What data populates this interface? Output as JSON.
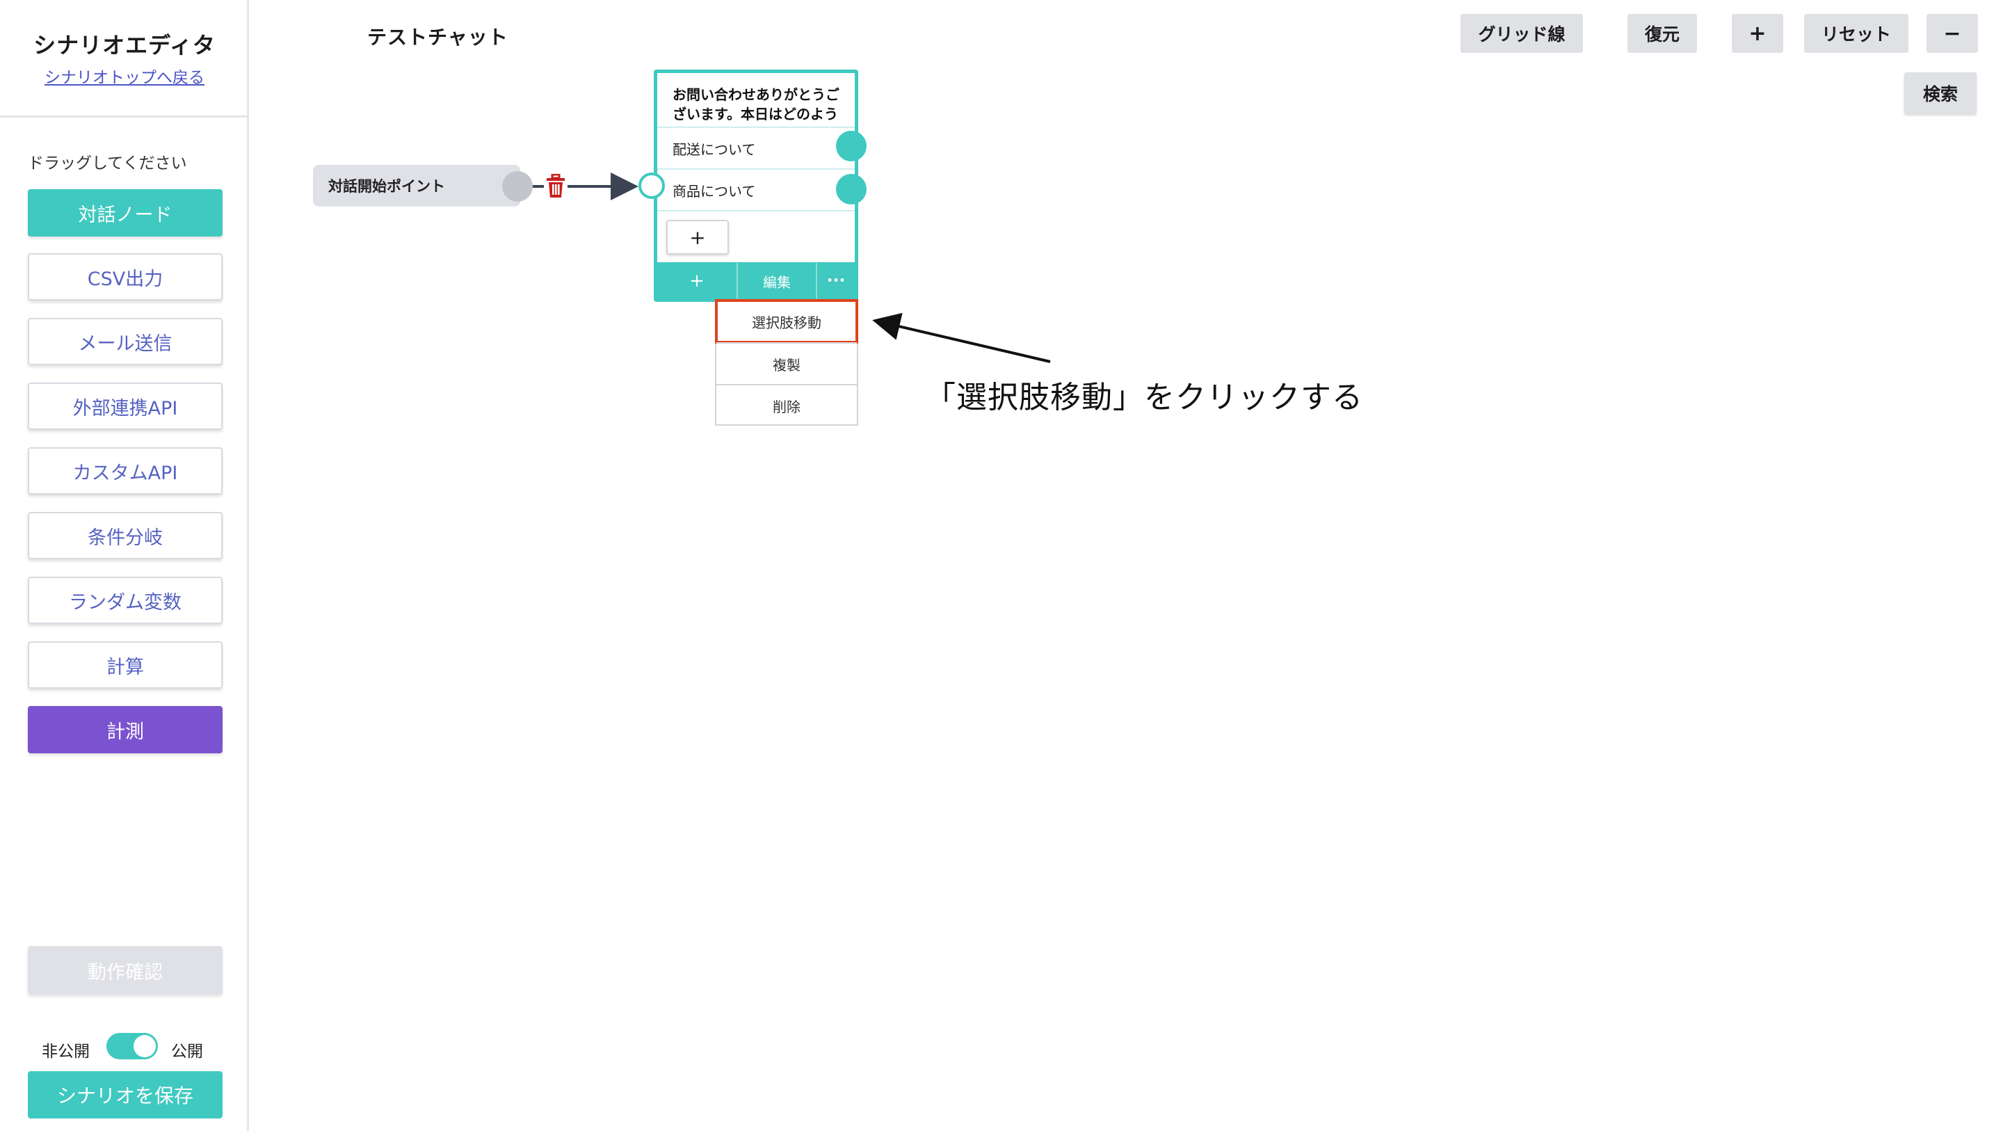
{
  "sidebar": {
    "title": "シナリオエディタ",
    "back_link": "シナリオトップへ戻る",
    "drag_hint": "ドラッグしてください",
    "node_buttons": [
      {
        "label": "対話ノード",
        "style": "teal"
      },
      {
        "label": "CSV出力",
        "style": "outline"
      },
      {
        "label": "メール送信",
        "style": "outline"
      },
      {
        "label": "外部連携API",
        "style": "outline"
      },
      {
        "label": "カスタムAPI",
        "style": "outline"
      },
      {
        "label": "条件分岐",
        "style": "outline"
      },
      {
        "label": "ランダム変数",
        "style": "outline"
      },
      {
        "label": "計算",
        "style": "outline"
      },
      {
        "label": "計測",
        "style": "purple"
      }
    ],
    "verify_button": "動作確認",
    "private_label": "非公開",
    "public_label": "公開",
    "publish_toggle_on": true,
    "save_button": "シナリオを保存"
  },
  "header": {
    "chat_title": "テストチャット",
    "toolbar": {
      "grid": "グリッド線",
      "restore": "復元",
      "zoom_in": "+",
      "reset": "リセット",
      "zoom_out": "−",
      "search": "検索"
    }
  },
  "canvas": {
    "start_point_label": "対話開始ポイント",
    "dialog_node": {
      "message": "お問い合わせありがとうご\nざいます。本日はどのよう",
      "choices": [
        "配送について",
        "商品について"
      ],
      "add_choice": "+",
      "footer": {
        "add": "+",
        "edit": "編集",
        "more": "•••"
      }
    },
    "context_menu": [
      "選択肢移動",
      "複製",
      "削除"
    ]
  },
  "annotation": {
    "text": "「選択肢移動」をクリックする",
    "highlight_color": "#e0431e"
  },
  "colors": {
    "accent": "#3fc9c0",
    "purple": "#7b52cf",
    "link": "#4a54c4"
  }
}
